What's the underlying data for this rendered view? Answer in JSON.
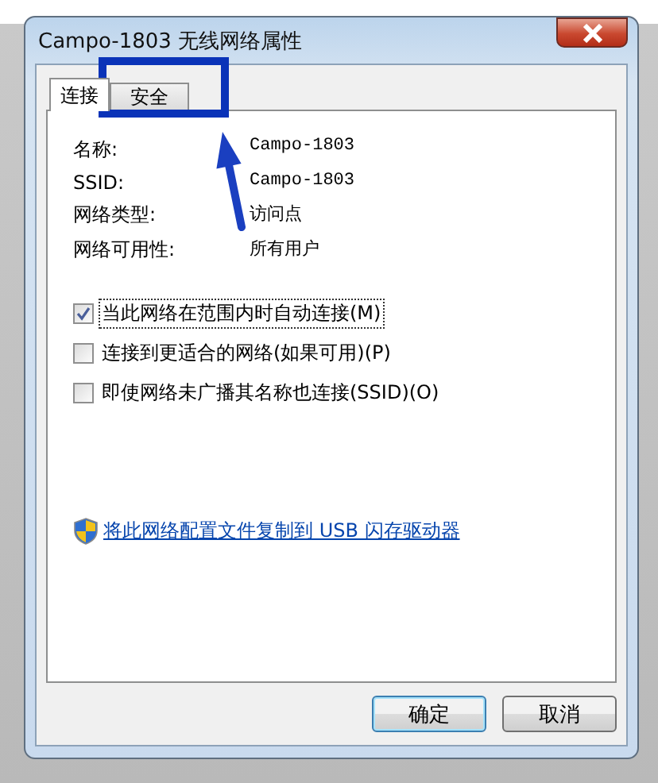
{
  "window": {
    "title": "Campo-1803 无线网络属性"
  },
  "tabs": [
    {
      "label": "连接",
      "selected": true
    },
    {
      "label": "安全",
      "selected": false
    }
  ],
  "properties": [
    {
      "label": "名称:",
      "value": "Campo-1803"
    },
    {
      "label": "SSID:",
      "value": "Campo-1803"
    },
    {
      "label": "网络类型:",
      "value": "访问点"
    },
    {
      "label": "网络可用性:",
      "value": "所有用户"
    }
  ],
  "options": [
    {
      "label": "当此网络在范围内时自动连接(M)",
      "checked": true,
      "focused": true
    },
    {
      "label": "连接到更适合的网络(如果可用)(P)",
      "checked": false,
      "focused": false
    },
    {
      "label": "即使网络未广播其名称也连接(SSID)(O)",
      "checked": false,
      "focused": false
    }
  ],
  "link": "将此网络配置文件复制到 USB 闪存驱动器",
  "buttons": [
    {
      "label": "确定",
      "default": true
    },
    {
      "label": "取消",
      "default": false
    }
  ]
}
